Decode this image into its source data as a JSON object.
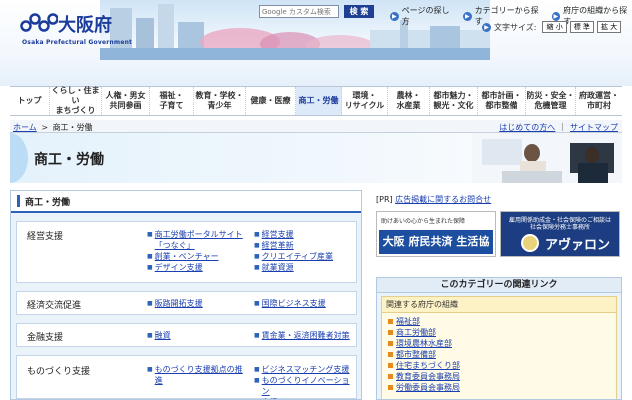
{
  "header": {
    "logo_text": "大阪府",
    "logo_sub": "Osaka Prefectural Government",
    "search_placeholder": "Google カスタム検索",
    "search_button": "検 索",
    "top_links": [
      "ページの探し方",
      "カテゴリーから探す",
      "府庁の組織から探す"
    ],
    "font_size_label": "文字サイズ:",
    "font_size_options": [
      "縮 小",
      "標 準",
      "拡 大"
    ]
  },
  "nav": {
    "items": [
      {
        "label": "トップ"
      },
      {
        "label": "くらし・住まい\nまちづくり"
      },
      {
        "label": "人権・男女\n共同参画"
      },
      {
        "label": "福祉・\n子育て"
      },
      {
        "label": "教育・学校・\n青少年"
      },
      {
        "label": "健康・医療"
      },
      {
        "label": "商工・労働"
      },
      {
        "label": "環境・\nリサイクル"
      },
      {
        "label": "農林・\n水産業"
      },
      {
        "label": "都市魅力・\n観光・文化"
      },
      {
        "label": "都市計画・\n都市整備"
      },
      {
        "label": "防災・安全・\n危機管理"
      },
      {
        "label": "府政運営・\n市町村"
      }
    ],
    "active_index": 6
  },
  "breadcrumb": {
    "home": "ホーム",
    "separator": ">",
    "current": "商工・労働",
    "right_links": [
      "はじめての方へ",
      "サイトマップ"
    ]
  },
  "page": {
    "title": "商工・労働"
  },
  "main": {
    "heading": "商工・労働",
    "rows": [
      {
        "category": "経営支援",
        "col1": [
          "商工労働ポータルサイト\n「つなぐ」",
          "創業・ベンチャー",
          "デザイン支援"
        ],
        "col2": [
          "経営支援",
          "経営革新",
          "クリエイティブ産業",
          "就業資源"
        ]
      },
      {
        "category": "経済交流促進",
        "col1": [
          "販路開拓支援"
        ],
        "col2": [
          "国際ビジネス支援"
        ]
      },
      {
        "category": "金融支援",
        "col1": [
          "融資"
        ],
        "col2": [
          "賃金業・返済困難者対策"
        ]
      },
      {
        "category": "ものづくり支援",
        "col1": [
          "ものづくり支援拠点の推\n進"
        ],
        "col2": [
          "ビジネスマッチング支援",
          "ものづくりイノベーション\n支援"
        ]
      }
    ]
  },
  "right": {
    "pr_tag": "[PR]",
    "pr_link": "広告掲載に関するお問合せ",
    "banner1_top": "助けあいの心から生まれた保障",
    "banner1_main": "大阪 府民共済 生活協同組合",
    "banner2_line1": "雇用関係助成金・社会保険のご相談は",
    "banner2_line2": "社会保険労務士事務所",
    "banner2_main": "アヴァロン",
    "related_heading": "このカテゴリーの関連リンク",
    "related_subhead": "関連する府庁の組織",
    "related_items": [
      "福祉部",
      "商工労働部",
      "環境農林水産部",
      "都市整備部",
      "住宅まちづくり部",
      "教育委員会事務局",
      "労働委員会事務局"
    ]
  },
  "colors": {
    "brand": "#1c3c9c",
    "nav_active": "#dce9f8",
    "link": "#1a3fb0",
    "panel_bg": "#eaf2fa",
    "accent_bar": "#2c63b8"
  }
}
